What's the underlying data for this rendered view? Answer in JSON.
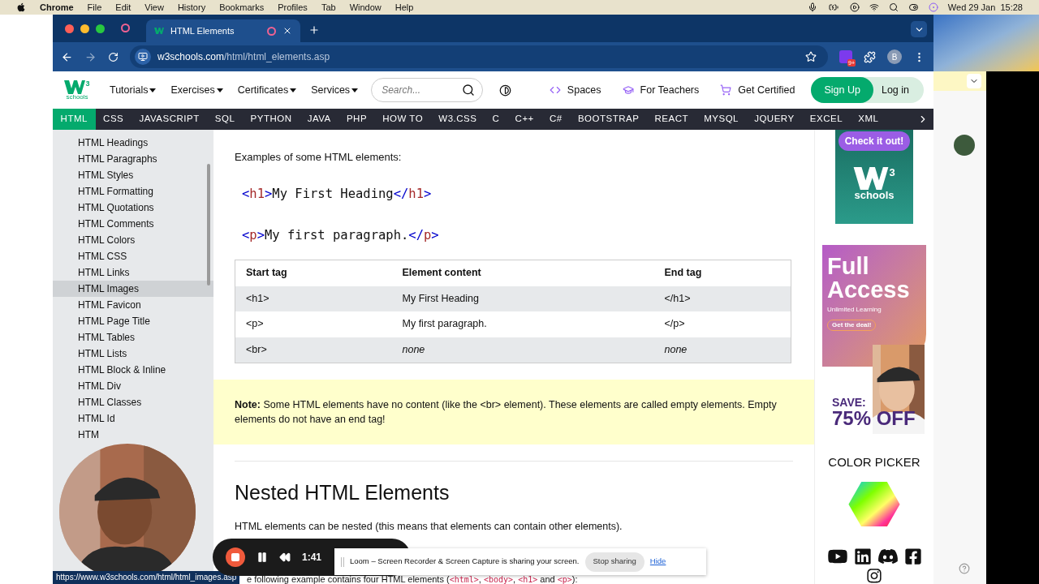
{
  "menu_bar": {
    "app": "Chrome",
    "menus": [
      "File",
      "Edit",
      "View",
      "History",
      "Bookmarks",
      "Profiles",
      "Tab",
      "Window",
      "Help"
    ],
    "clock": "Wed 29 Jan  15:28"
  },
  "browser": {
    "tabs": [
      {
        "title": "HTML Elements",
        "selected": true
      }
    ],
    "url_host": "w3schools.com",
    "url_path": "/html/html_elements.asp",
    "extension_badge": "9+",
    "profile": "B"
  },
  "site_header": {
    "logo_sup": "3",
    "logo_text": "schools",
    "menus": [
      "Tutorials",
      "Exercises",
      "Certificates",
      "Services"
    ],
    "search_placeholder": "Search...",
    "links": [
      {
        "kind": "code",
        "label": "Spaces"
      },
      {
        "kind": "cap",
        "label": "For Teachers"
      },
      {
        "kind": "cart",
        "label": "Get Certified"
      }
    ],
    "sign_up": "Sign Up",
    "log_in": "Log in"
  },
  "topnav": {
    "items": [
      {
        "label": "HTML",
        "selected": true
      },
      {
        "label": "CSS",
        "selected": false
      },
      {
        "label": "JAVASCRIPT",
        "selected": false
      },
      {
        "label": "SQL",
        "selected": false
      },
      {
        "label": "PYTHON",
        "selected": false
      },
      {
        "label": "JAVA",
        "selected": false
      },
      {
        "label": "PHP",
        "selected": false
      },
      {
        "label": "HOW TO",
        "selected": false
      },
      {
        "label": "W3.CSS",
        "selected": false
      },
      {
        "label": "C",
        "selected": false
      },
      {
        "label": "C++",
        "selected": false
      },
      {
        "label": "C#",
        "selected": false
      },
      {
        "label": "BOOTSTRAP",
        "selected": false
      },
      {
        "label": "REACT",
        "selected": false
      },
      {
        "label": "MYSQL",
        "selected": false
      },
      {
        "label": "JQUERY",
        "selected": false
      },
      {
        "label": "EXCEL",
        "selected": false
      },
      {
        "label": "XML",
        "selected": false
      }
    ]
  },
  "sidebar": {
    "items": [
      {
        "label": "HTML Headings",
        "hovered": false
      },
      {
        "label": "HTML Paragraphs",
        "hovered": false
      },
      {
        "label": "HTML Styles",
        "hovered": false
      },
      {
        "label": "HTML Formatting",
        "hovered": false
      },
      {
        "label": "HTML Quotations",
        "hovered": false
      },
      {
        "label": "HTML Comments",
        "hovered": false
      },
      {
        "label": "HTML Colors",
        "hovered": false
      },
      {
        "label": "HTML CSS",
        "hovered": false
      },
      {
        "label": "HTML Links",
        "hovered": false
      },
      {
        "label": "HTML Images",
        "hovered": true
      },
      {
        "label": "HTML Favicon",
        "hovered": false
      },
      {
        "label": "HTML Page Title",
        "hovered": false
      },
      {
        "label": "HTML Tables",
        "hovered": false
      },
      {
        "label": "HTML Lists",
        "hovered": false
      },
      {
        "label": "HTML Block & Inline",
        "hovered": false
      },
      {
        "label": "HTML Div",
        "hovered": false
      },
      {
        "label": "HTML Classes",
        "hovered": false
      },
      {
        "label": "HTML Id",
        "hovered": false
      },
      {
        "label": "HTM",
        "hovered": false
      }
    ]
  },
  "content": {
    "intro": "Examples of some HTML elements:",
    "examples": [
      [
        {
          "kind": "bracket",
          "text": "<"
        },
        {
          "kind": "tag",
          "text": "h1"
        },
        {
          "kind": "bracket",
          "text": ">"
        },
        {
          "kind": "text",
          "text": "My First Heading"
        },
        {
          "kind": "bracket",
          "text": "</"
        },
        {
          "kind": "tag",
          "text": "h1"
        },
        {
          "kind": "bracket",
          "text": ">"
        }
      ],
      [
        {
          "kind": "bracket",
          "text": "<"
        },
        {
          "kind": "tag",
          "text": "p"
        },
        {
          "kind": "bracket",
          "text": ">"
        },
        {
          "kind": "text",
          "text": "My first paragraph."
        },
        {
          "kind": "bracket",
          "text": "</"
        },
        {
          "kind": "tag",
          "text": "p"
        },
        {
          "kind": "bracket",
          "text": ">"
        }
      ]
    ],
    "table": {
      "columns": [
        "Start tag",
        "Element content",
        "End tag"
      ],
      "rows": [
        [
          {
            "text": "<h1>",
            "italic": false
          },
          {
            "text": "My First Heading",
            "italic": false
          },
          {
            "text": "</h1>",
            "italic": false
          }
        ],
        [
          {
            "text": "<p>",
            "italic": false
          },
          {
            "text": "My first paragraph.",
            "italic": false
          },
          {
            "text": "</p>",
            "italic": false
          }
        ],
        [
          {
            "text": "<br>",
            "italic": false
          },
          {
            "text": "none",
            "italic": true
          },
          {
            "text": "none",
            "italic": true
          }
        ]
      ]
    },
    "note": "**Note:** Some HTML elements have no content (like the <br> element). These elements are called empty elements. Empty elements do not have an end tag!",
    "heading": "Nested HTML Elements",
    "paragraph": "HTML elements can be nested (this means that elements can contain other elements).",
    "cut_line": [
      {
        "kind": "text",
        "text": "e following example contains four HTML elements ("
      },
      {
        "kind": "code",
        "text": "<html>"
      },
      {
        "kind": "text",
        "text": ", "
      },
      {
        "kind": "code",
        "text": "<body>"
      },
      {
        "kind": "text",
        "text": ", "
      },
      {
        "kind": "code",
        "text": "<h1>"
      },
      {
        "kind": "text",
        "text": " and "
      },
      {
        "kind": "code",
        "text": "<p>"
      },
      {
        "kind": "text",
        "text": "):"
      }
    ]
  },
  "ads": {
    "check_button": "Check it out!",
    "logo_sup": "3",
    "logo_text": "schools",
    "full_access": {
      "title": "Full Access",
      "subtitle": "Unlimited Learning",
      "button": "Get the deal!",
      "save": "SAVE:",
      "discount": "75% OFF"
    },
    "color_picker": "COLOR PICKER"
  },
  "recorder": {
    "time": "1:41"
  },
  "share_banner": {
    "message": "Loom – Screen Recorder & Screen Capture is sharing your screen.",
    "stop": "Stop sharing",
    "hide": "Hide"
  },
  "status_url": "https://www.w3schools.com/html/html_images.asp"
}
